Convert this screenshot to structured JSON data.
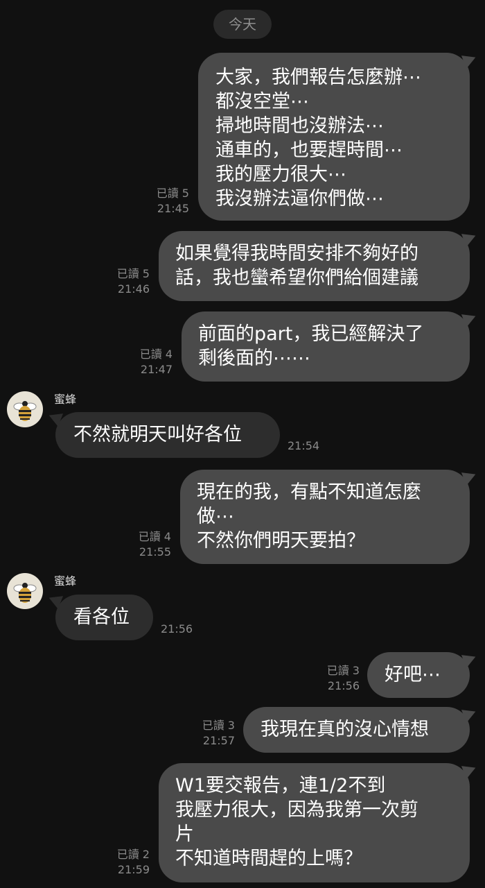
{
  "date_divider": "今天",
  "messages": [
    {
      "text": "大家，我們報告怎麼辦⋯\n都沒空堂⋯\n掃地時間也沒辦法⋯\n通車的，也要趕時間⋯\n我的壓力很大⋯\n我沒辦法逼你們做⋯",
      "read": "已讀 5",
      "time": "21:45"
    },
    {
      "text": "如果覺得我時間安排不夠好的\n話，我也蠻希望你們給個建議",
      "read": "已讀 5",
      "time": "21:46"
    },
    {
      "text": "前面的part，我已經解決了\n剩後面的⋯⋯",
      "read": "已讀 4",
      "time": "21:47"
    },
    {
      "sender": "蜜蜂",
      "text": "不然就明天叫好各位",
      "time": "21:54"
    },
    {
      "text": "現在的我，有點不知道怎麼\n做⋯\n不然你們明天要拍？",
      "read": "已讀 4",
      "time": "21:55"
    },
    {
      "sender": "蜜蜂",
      "text": "看各位",
      "time": "21:56"
    },
    {
      "text": "好吧⋯",
      "read": "已讀 3",
      "time": "21:56"
    },
    {
      "text": "我現在真的沒心情想",
      "read": "已讀 3",
      "time": "21:57"
    },
    {
      "text": "W1要交報告，連1/2不到\n我壓力很大，因為我第一次剪\n片\n不知道時間趕的上嗎？",
      "read": "已讀 2",
      "time": "21:59"
    }
  ]
}
